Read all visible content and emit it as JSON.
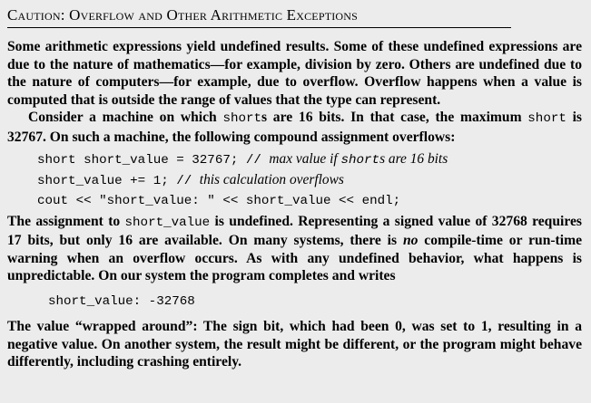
{
  "title": "Caution: Overflow and Other Arithmetic Exceptions",
  "para1": "Some arithmetic expressions yield undefined results. Some of these undefined expressions are due to the nature of mathematics—for example, division by zero. Others are undefined due to the nature of computers—for example, due to overflow. Overflow happens when a value is computed that is outside the range of values that the type can represent.",
  "para2": {
    "t1": "Consider a machine on which ",
    "c1": "short",
    "t2": "s are 16 bits. In that case, the maximum ",
    "c2": "short",
    "t3": " is 32767. On such a machine, the following compound assignment overflows:"
  },
  "code": {
    "line1_code": "short short_value = 32767; // ",
    "line1_c1": "max value if ",
    "line1_c2": "short",
    "line1_c3": "s are 16 bits",
    "line2_code": "short_value += 1; // ",
    "line2_comment": "this calculation overflows",
    "line3_code": "cout << \"short_value: \" << short_value << endl;"
  },
  "para3": {
    "t1": "The assignment to ",
    "c1": "short_value",
    "t2": " is undefined. Representing a signed value of 32768 requires 17 bits, but only 16 are available. On many systems, there is ",
    "em": "no",
    "t3": " compile-time or run-time warning when an overflow occurs. As with any undefined behavior, what happens is unpredictable. On our system the program completes and writes"
  },
  "output": "short_value: -32768",
  "para4": "The value “wrapped around”: The sign bit, which had been 0, was set to 1, resulting in a negative value. On another system, the result might be different, or the program might behave differently, including crashing entirely."
}
